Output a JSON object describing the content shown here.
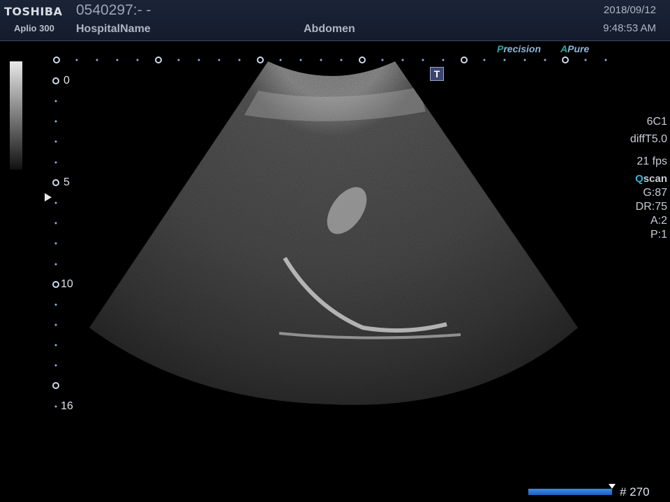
{
  "header": {
    "brand": "TOSHIBA",
    "model": "Aplio 300",
    "patient_id": "0540297:- -",
    "hospital": "HospitalName",
    "exam": "Abdomen",
    "date": "2018/09/12",
    "time": "9:48:53 AM"
  },
  "badges": {
    "precision_prefix": "P",
    "precision_rest": "recision",
    "apure_prefix": "A",
    "apure_rest": "Pure",
    "t_marker": "T"
  },
  "scale": {
    "depth_labels": [
      "0",
      "5",
      "10",
      "16"
    ]
  },
  "params": {
    "probe": "6C1",
    "preset": "diffT5.0",
    "fps": "21 fps",
    "qscan_prefix": "Q",
    "qscan_rest": "scan",
    "gain": "G:87",
    "dynamic_range": "DR:75",
    "a": "A:2",
    "p": "P:1"
  },
  "cine": {
    "frame_label": "# 270"
  },
  "colors": {
    "header_bg": "#1a2436",
    "accent_teal": "#2fa8a0",
    "cine_bar": "#2b78d8"
  }
}
